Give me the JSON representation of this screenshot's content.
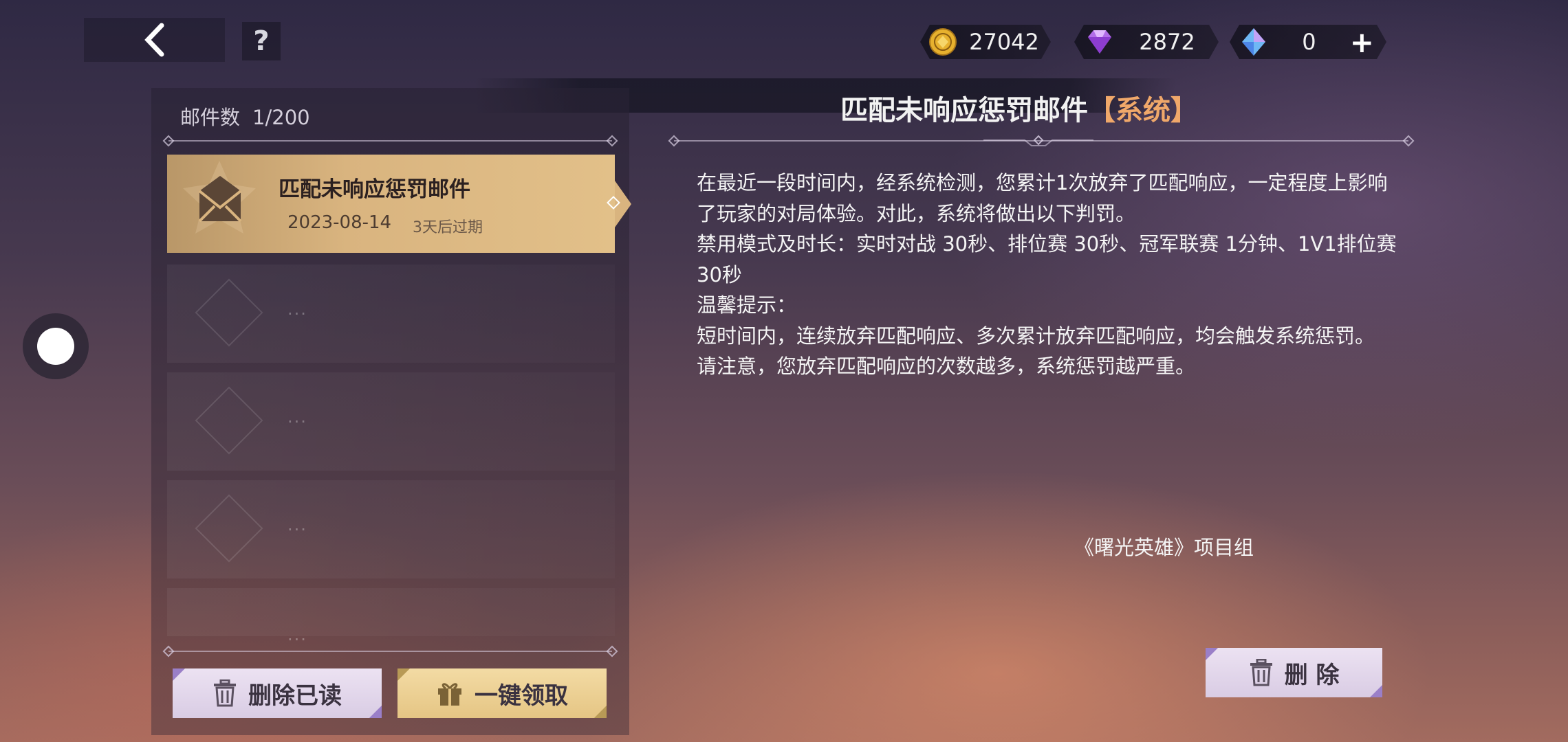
{
  "topbar": {
    "currencies": [
      {
        "icon": "gold-coin-icon",
        "value": "27042"
      },
      {
        "icon": "purple-diamond-icon",
        "value": "2872"
      },
      {
        "icon": "blue-crystal-icon",
        "value": "0"
      }
    ],
    "help_label": "?",
    "plus_label": "+"
  },
  "mailbox": {
    "count_label": "邮件数",
    "count_value": "1/200",
    "items": [
      {
        "title": "匹配未响应惩罚邮件",
        "date": "2023-08-14",
        "expire": "3天后过期",
        "selected": true
      }
    ],
    "empty_dots": "...",
    "delete_read_label": "删除已读",
    "claim_all_label": "一键领取"
  },
  "mail": {
    "title": "匹配未响应惩罚邮件",
    "tag": "【系统】",
    "paragraphs": [
      "在最近一段时间内，经系统检测，您累计1次放弃了匹配响应，一定程度上影响了玩家的对局体验。对此，系统将做出以下判罚。",
      "禁用模式及时长：实时对战 30秒、排位赛 30秒、冠军联赛 1分钟、1V1排位赛 30秒",
      "",
      "温馨提示：",
      "短时间内，连续放弃匹配响应、多次累计放弃匹配响应，均会触发系统惩罚。",
      "请注意，您放弃匹配响应的次数越多，系统惩罚越严重。"
    ],
    "signature": "《曙光英雄》项目组",
    "delete_label": "删 除"
  },
  "colors": {
    "accent_gold": "#d9b47f",
    "tag_orange": "#f0a86a",
    "button_lilac": "#e3d7ec"
  }
}
